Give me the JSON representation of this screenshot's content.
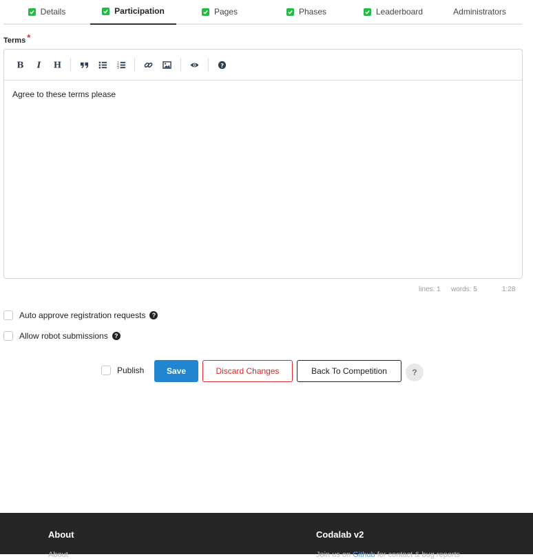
{
  "tabs": [
    {
      "label": "Details",
      "checked": true
    },
    {
      "label": "Participation",
      "checked": true,
      "active": true
    },
    {
      "label": "Pages",
      "checked": true
    },
    {
      "label": "Phases",
      "checked": true
    },
    {
      "label": "Leaderboard",
      "checked": true
    },
    {
      "label": "Administrators",
      "checked": false
    }
  ],
  "terms": {
    "label": "Terms",
    "required_mark": "*",
    "toolbar_icons": [
      "bold-icon",
      "italic-icon",
      "heading-icon",
      "quote-icon",
      "unordered-list-icon",
      "ordered-list-icon",
      "link-icon",
      "image-icon",
      "preview-icon",
      "guide-icon"
    ],
    "content": "Agree to these terms please",
    "status": {
      "lines": "lines: 1",
      "words": "words: 5",
      "cursor": "1:28"
    }
  },
  "options": {
    "auto_approve": "Auto approve registration requests",
    "allow_robot": "Allow robot submissions"
  },
  "actions": {
    "publish": "Publish",
    "save": "Save",
    "discard": "Discard Changes",
    "back": "Back To Competition",
    "help": "?"
  },
  "footer": {
    "about_heading": "About",
    "about_link": "About",
    "codalab_heading": "Codalab v2",
    "codalab_text_prefix": "Join us on",
    "codalab_link": "Github",
    "codalab_text_suffix": "for contact & bug reports"
  },
  "colors": {
    "accent": "#2185d0",
    "success": "#21ba45",
    "danger": "#db2828",
    "footer_bg": "#262626"
  }
}
